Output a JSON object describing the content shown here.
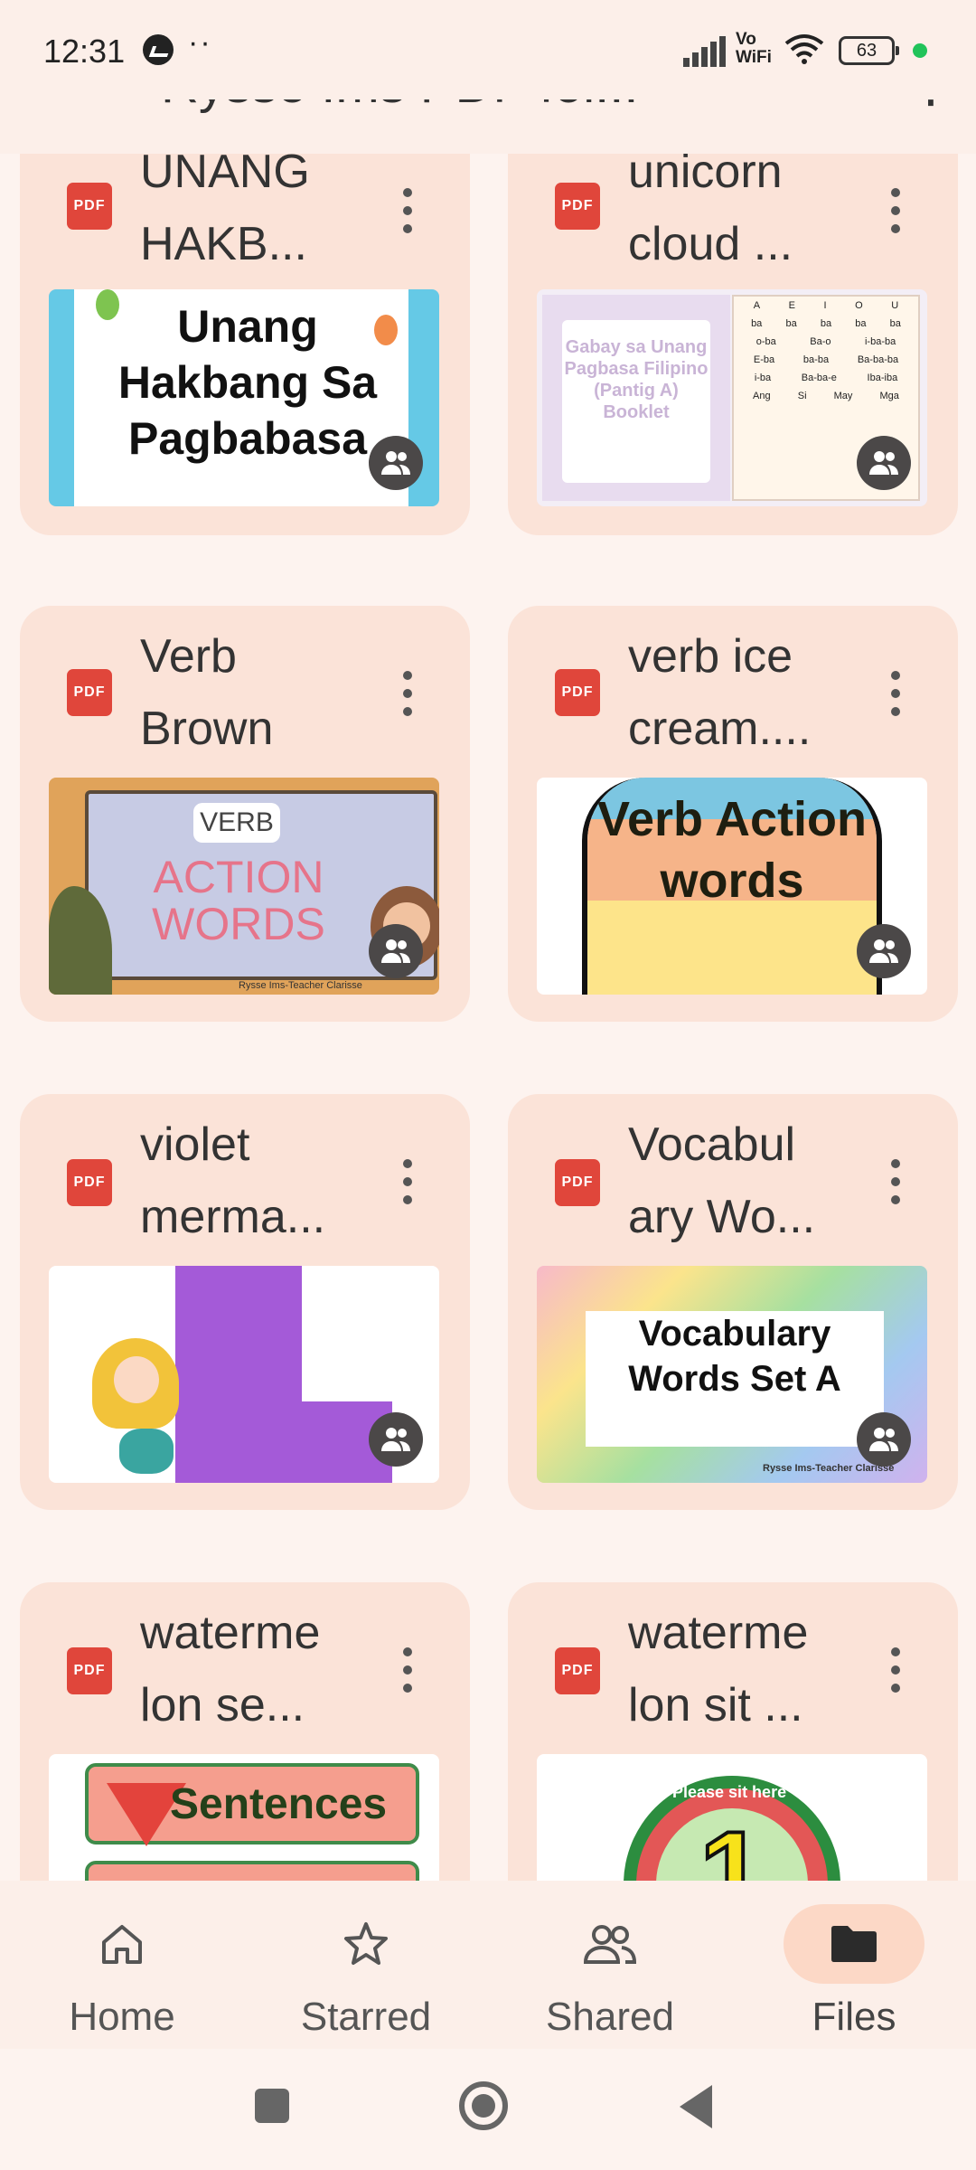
{
  "status_bar": {
    "time": "12:31",
    "dots": "··",
    "network": "Vo WiFi",
    "battery": "63"
  },
  "top_bar": {
    "title": "Rysse Ims PDF fol..."
  },
  "files": [
    {
      "name": "UNANG HAKB...",
      "type": "PDF",
      "thumb_text": "Unang Hakbang Sa Pagbabasa"
    },
    {
      "name": "unicorn cloud ...",
      "type": "PDF",
      "thumb_text": "Gabay sa Unang Pagbasa Filipino (Pantig A) Booklet"
    },
    {
      "name": "Verb Brown",
      "type": "PDF",
      "thumb_text_1": "VERB",
      "thumb_text_2": "ACTION WORDS",
      "thumb_credit": "Rysse Ims-Teacher Clarisse"
    },
    {
      "name": "verb ice cream....",
      "type": "PDF",
      "thumb_text": "Verb Action words"
    },
    {
      "name": "violet merma...",
      "type": "PDF"
    },
    {
      "name": "Vocabul ary Wo...",
      "type": "PDF",
      "thumb_text": "Vocabulary Words Set A",
      "thumb_credit": "Rysse Ims-Teacher Clarisse"
    },
    {
      "name": "waterme lon se...",
      "type": "PDF",
      "thumb_text": "Sentences"
    },
    {
      "name": "waterme lon sit ...",
      "type": "PDF",
      "thumb_text": "Please sit here",
      "thumb_number": "1"
    }
  ],
  "bottom_nav": [
    {
      "label": "Home",
      "icon": "home-icon",
      "active": false
    },
    {
      "label": "Starred",
      "icon": "star-icon",
      "active": false
    },
    {
      "label": "Shared",
      "icon": "people-icon",
      "active": false
    },
    {
      "label": "Files",
      "icon": "folder-icon",
      "active": true
    }
  ],
  "colors": {
    "card": "#fbe3d8",
    "pdf_badge": "#e0463b",
    "active_nav": "#fcd8c6",
    "background": "#fdf3ef"
  }
}
